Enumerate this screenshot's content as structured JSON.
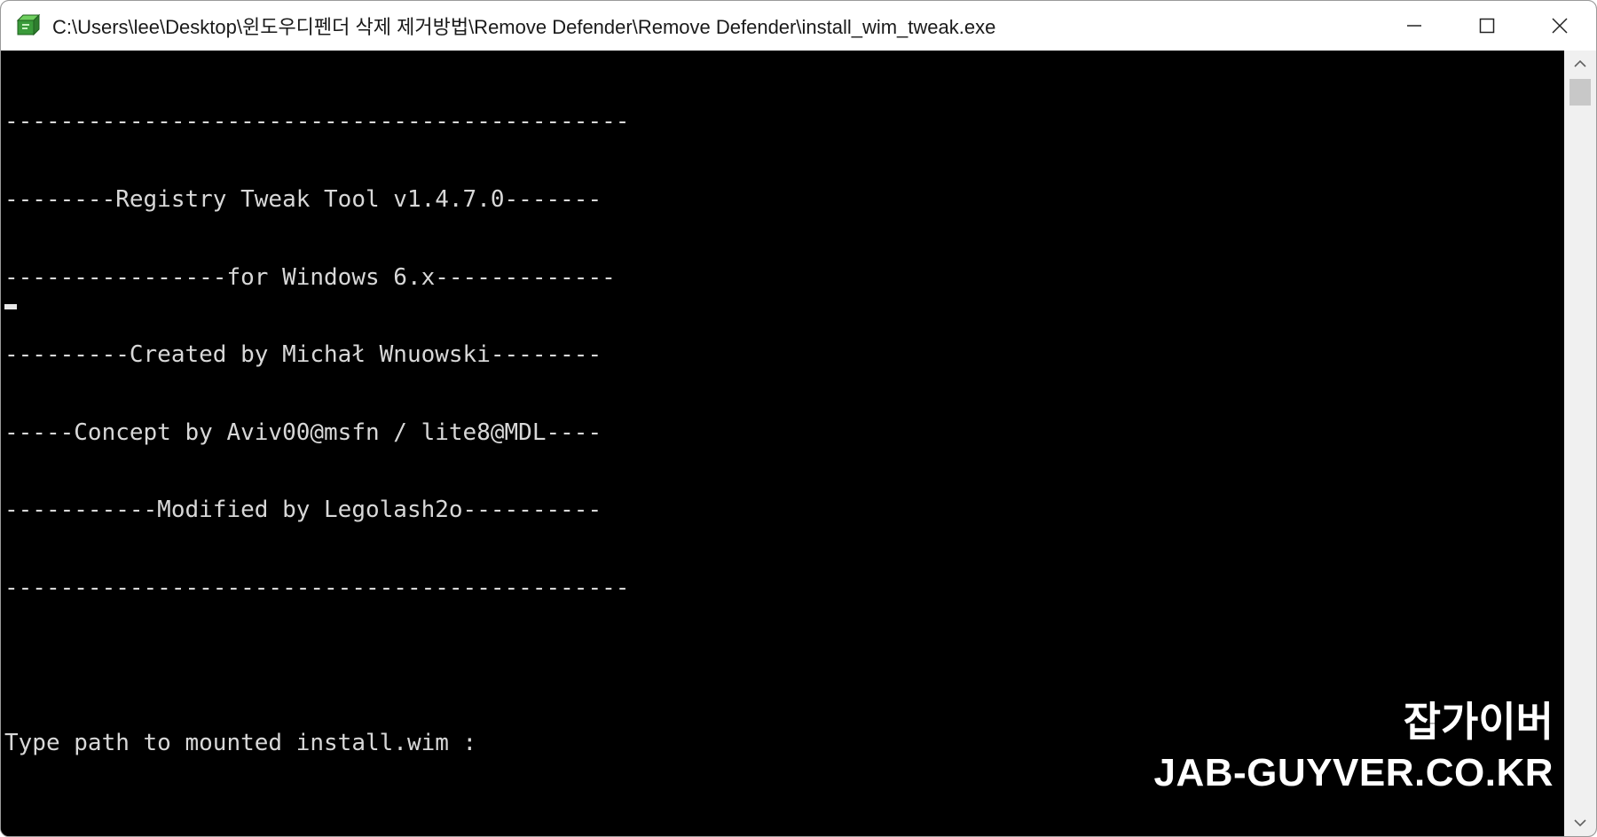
{
  "window": {
    "title": "C:\\Users\\lee\\Desktop\\윈도우디펜더 삭제 제거방법\\Remove Defender\\Remove Defender\\install_wim_tweak.exe",
    "icon": "console-app-icon",
    "controls": {
      "minimize": "minimize-icon",
      "maximize": "maximize-icon",
      "close": "close-icon"
    }
  },
  "console": {
    "lines": [
      "---------------------------------------------",
      "--------Registry Tweak Tool v1.4.7.0-------",
      "----------------for Windows 6.x-------------",
      "---------Created by Michał Wnuowski--------",
      "-----Concept by Aviv00@msfn / lite8@MDL----",
      "-----------Modified by Legolash2o----------",
      "---------------------------------------------",
      "",
      "Type path to mounted install.wim :"
    ],
    "text_color": "#d8d8d8",
    "background": "#000000"
  },
  "watermark": {
    "korean": "잡가이버",
    "domain": "JAB-GUYVER.CO.KR"
  },
  "scrollbar": {
    "up": "scroll-up-arrow-icon",
    "down": "scroll-down-arrow-icon"
  }
}
